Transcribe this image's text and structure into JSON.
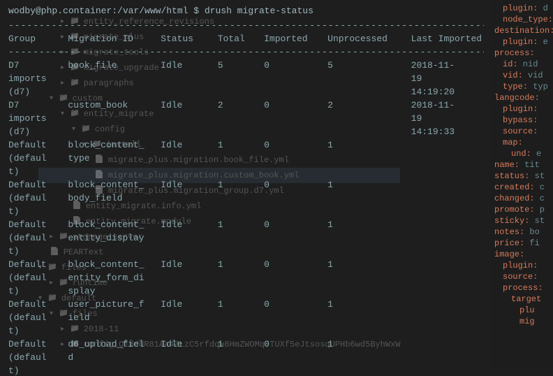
{
  "prompt": "wodby@php.container:/var/www/html $",
  "command": "drush migrate-status",
  "dash": "------------------------------------------------------------------------------------------------",
  "headers": {
    "group": "Group",
    "migid": "Migration ID",
    "status": "Status",
    "total": "Total",
    "imported": "Imported",
    "unprocessed": "Unprocessed",
    "last": "Last Imported"
  },
  "rows": [
    {
      "group": "D7 imports (d7)",
      "migid": "book_file",
      "status": "Idle",
      "total": "5",
      "imported": "0",
      "unproc": "5",
      "last": "2018-11-19 14:19:20"
    },
    {
      "group": "D7 imports (d7)",
      "migid": "custom_book",
      "status": "Idle",
      "total": "2",
      "imported": "0",
      "unproc": "2",
      "last": "2018-11-19 14:19:33"
    },
    {
      "group": "Default (default)",
      "migid": "block_content_type",
      "status": "Idle",
      "total": "1",
      "imported": "0",
      "unproc": "1",
      "last": ""
    },
    {
      "group": "Default (default)",
      "migid": "block_content_body_field",
      "status": "Idle",
      "total": "1",
      "imported": "0",
      "unproc": "1",
      "last": ""
    },
    {
      "group": "Default (default)",
      "migid": "block_content_entity_display",
      "status": "Idle",
      "total": "1",
      "imported": "0",
      "unproc": "1",
      "last": ""
    },
    {
      "group": "Default (default)",
      "migid": "block_content_entity_form_display",
      "status": "Idle",
      "total": "1",
      "imported": "0",
      "unproc": "1",
      "last": ""
    },
    {
      "group": "Default (default)",
      "migid": "user_picture_field",
      "status": "Idle",
      "total": "1",
      "imported": "0",
      "unproc": "1",
      "last": ""
    },
    {
      "group": "Default (default)",
      "migid": "d6_upload_field",
      "status": "Idle",
      "total": "1",
      "imported": "0",
      "unproc": "1",
      "last": ""
    }
  ],
  "filetree": [
    {
      "type": "folder",
      "name": "entity_reference_revisions",
      "indent": 0,
      "chev": "right"
    },
    {
      "type": "folder",
      "name": "migrate_plus",
      "indent": 0,
      "chev": "right"
    },
    {
      "type": "folder",
      "name": "migrate_tools",
      "indent": 0,
      "chev": "right"
    },
    {
      "type": "folder",
      "name": "migrate_upgrade",
      "indent": 0,
      "chev": "right"
    },
    {
      "type": "folder",
      "name": "paragraphs",
      "indent": 0,
      "chev": "right"
    },
    {
      "type": "folder",
      "name": "custom",
      "indent": -1,
      "chev": "down"
    },
    {
      "type": "folder",
      "name": "entity_migrate",
      "indent": 0,
      "chev": "down"
    },
    {
      "type": "folder",
      "name": "config",
      "indent": 1,
      "chev": "down"
    },
    {
      "type": "folder",
      "name": "install",
      "indent": 2,
      "chev": "down"
    },
    {
      "type": "file",
      "name": "migrate_plus.migration.book_file.yml",
      "indent": 3
    },
    {
      "type": "file",
      "name": "migrate_plus.migration.custom_book.yml",
      "indent": 3,
      "hl": true
    },
    {
      "type": "file",
      "name": "migrate_plus.migration_group.d7.yml",
      "indent": 3
    },
    {
      "type": "file",
      "name": "entity_migrate.info.yml",
      "indent": 1
    },
    {
      "type": "file",
      "name": "entity_migrate.module",
      "indent": 1
    },
    {
      "type": "folder",
      "name": "storage_server",
      "indent": -1,
      "chev": "right"
    },
    {
      "type": "file",
      "name": "PEARText",
      "indent": -1
    },
    {
      "type": "folder",
      "name": "files",
      "indent": -2,
      "chev": "down"
    },
    {
      "type": "folder",
      "name": "runtime",
      "indent": -1,
      "chev": "right"
    },
    {
      "type": "blank",
      "name": "",
      "indent": 0
    },
    {
      "type": "folder",
      "name": "default",
      "indent": -2,
      "chev": "down"
    },
    {
      "type": "folder",
      "name": "files",
      "indent": -1,
      "chev": "down"
    },
    {
      "type": "folder",
      "name": "2018-11",
      "indent": 0,
      "chev": "right"
    },
    {
      "type": "folder",
      "name": "config_QIddUR81Aa4ZLzC5rfdqw8HmZWOMqJTUXf5eJtsosqUPHb6wd5ByhWxW",
      "indent": 0,
      "chev": "right"
    }
  ],
  "yaml": [
    {
      "key": "plugin:",
      "val": " d",
      "indent": 1
    },
    {
      "key": "node_type:",
      "val": "",
      "indent": 1
    },
    {
      "key": "destination:",
      "val": "",
      "indent": 0
    },
    {
      "key": "plugin:",
      "val": " e",
      "indent": 1
    },
    {
      "key": "",
      "val": "",
      "indent": 0
    },
    {
      "key": "process:",
      "val": "",
      "indent": 0
    },
    {
      "key": "id:",
      "val": " nid",
      "indent": 1
    },
    {
      "key": "vid:",
      "val": " vid",
      "indent": 1
    },
    {
      "key": "type:",
      "val": " typ",
      "indent": 1
    },
    {
      "key": "langcode:",
      "val": "",
      "indent": 0
    },
    {
      "key": "plugin:",
      "val": "",
      "indent": 1
    },
    {
      "key": "bypass:",
      "val": "",
      "indent": 1
    },
    {
      "key": "source:",
      "val": "",
      "indent": 1
    },
    {
      "key": "map:",
      "val": "",
      "indent": 1
    },
    {
      "key": "und:",
      "val": " e",
      "indent": 2
    },
    {
      "key": "name:",
      "val": " tit",
      "indent": 0
    },
    {
      "key": "status:",
      "val": " st",
      "indent": 0
    },
    {
      "key": "created:",
      "val": " c",
      "indent": 0
    },
    {
      "key": "changed:",
      "val": " c",
      "indent": 0
    },
    {
      "key": "promote:",
      "val": " p",
      "indent": 0
    },
    {
      "key": "sticky:",
      "val": " st",
      "indent": 0
    },
    {
      "key": "notes:",
      "val": " bo",
      "indent": 0
    },
    {
      "key": "price:",
      "val": " fi",
      "indent": 0
    },
    {
      "key": "image:",
      "val": "",
      "indent": 0
    },
    {
      "key": "plugin:",
      "val": "",
      "indent": 1
    },
    {
      "key": "source:",
      "val": "",
      "indent": 1
    },
    {
      "key": "process:",
      "val": "",
      "indent": 1
    },
    {
      "key": "target",
      "val": "",
      "indent": 2
    },
    {
      "key": "plu",
      "val": "",
      "indent": 3
    },
    {
      "key": "mig",
      "val": "",
      "indent": 3
    }
  ]
}
